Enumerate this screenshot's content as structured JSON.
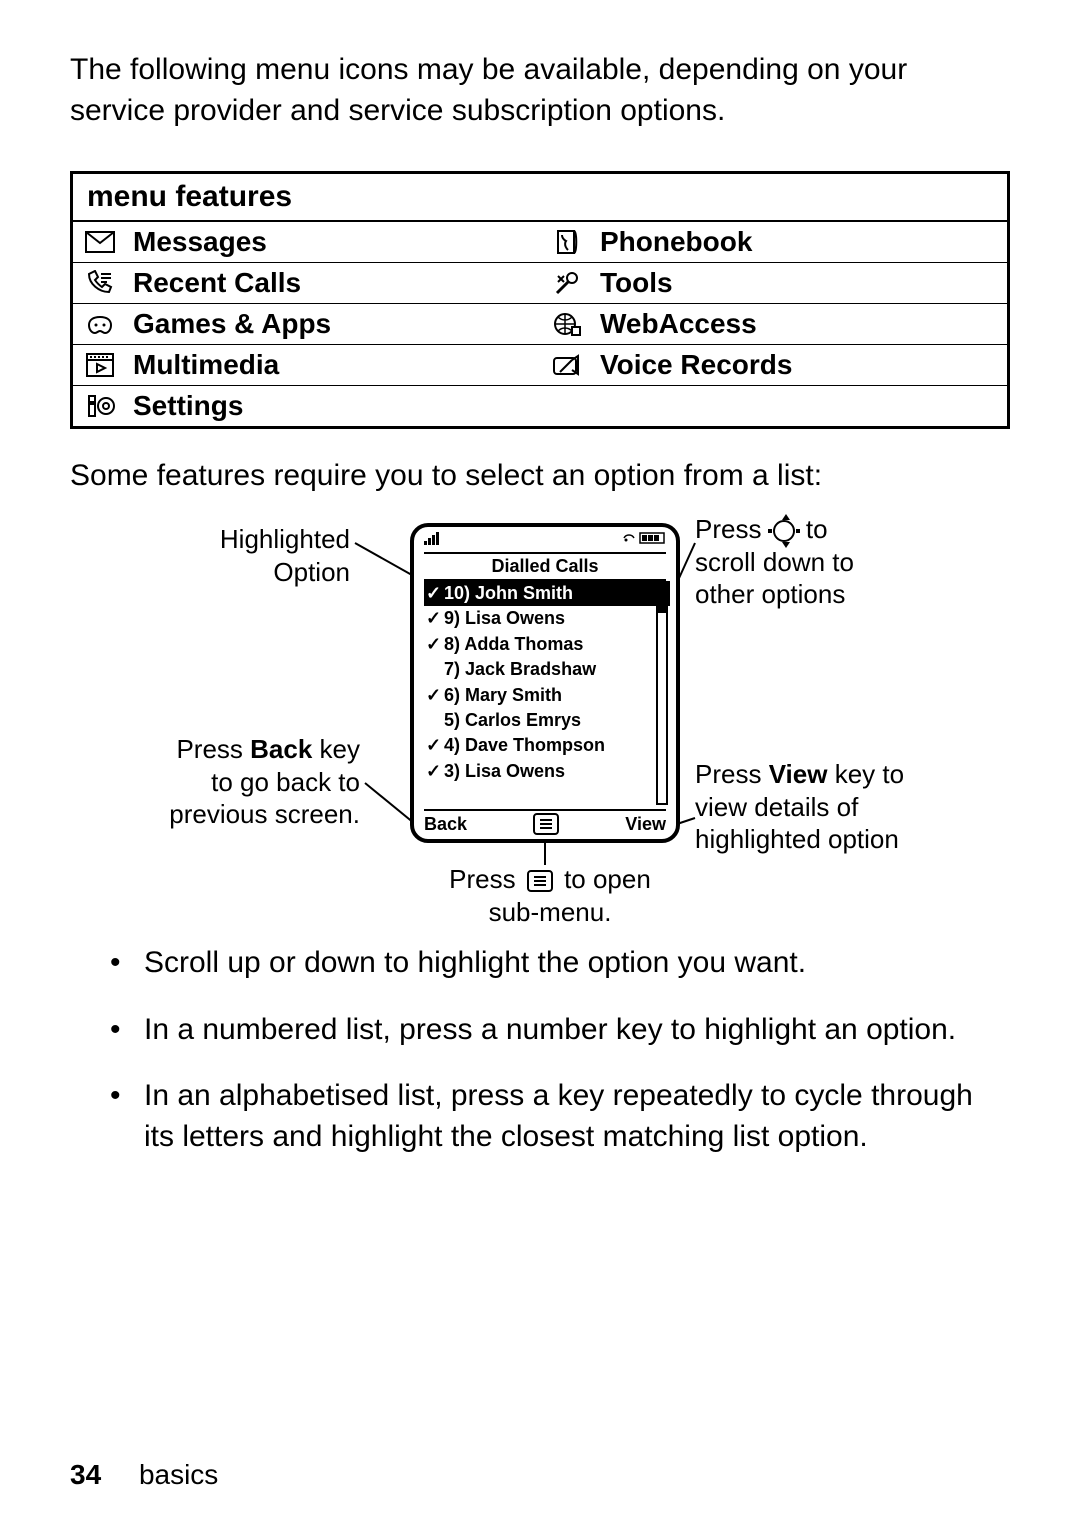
{
  "intro": "The following menu icons may be available, depending on your service provider and service subscription options.",
  "menu": {
    "header": "menu features",
    "rows": [
      {
        "left": {
          "icon": "envelope-icon",
          "label": "Messages"
        },
        "right": {
          "icon": "phonebook-icon",
          "label": "Phonebook"
        }
      },
      {
        "left": {
          "icon": "recent-calls-icon",
          "label": "Recent Calls"
        },
        "right": {
          "icon": "tools-icon",
          "label": "Tools"
        }
      },
      {
        "left": {
          "icon": "games-icon",
          "label": "Games & Apps"
        },
        "right": {
          "icon": "globe-icon",
          "label": "WebAccess"
        }
      },
      {
        "left": {
          "icon": "multimedia-icon",
          "label": "Multimedia"
        },
        "right": {
          "icon": "voice-records-icon",
          "label": "Voice Records"
        }
      },
      {
        "left": {
          "icon": "settings-icon",
          "label": "Settings"
        },
        "right": null
      }
    ]
  },
  "mid": "Some features require you to select an option from a list:",
  "phone": {
    "title": "Dialled Calls",
    "entries": [
      {
        "chk": true,
        "n": "10",
        "name": "John Smith",
        "hl": true
      },
      {
        "chk": true,
        "n": "9",
        "name": "Lisa Owens"
      },
      {
        "chk": true,
        "n": "8",
        "name": "Adda Thomas"
      },
      {
        "chk": false,
        "n": "7",
        "name": "Jack Bradshaw"
      },
      {
        "chk": true,
        "n": "6",
        "name": "Mary Smith"
      },
      {
        "chk": false,
        "n": "5",
        "name": "Carlos Emrys"
      },
      {
        "chk": true,
        "n": "4",
        "name": "Dave Thompson"
      },
      {
        "chk": true,
        "n": "3",
        "name": "Lisa Owens"
      }
    ],
    "left_soft": "Back",
    "right_soft": "View"
  },
  "callouts": {
    "highlighted_l1": "Highlighted",
    "highlighted_l2": "Option",
    "scroll_l1": "Press ",
    "scroll_l2": " to",
    "scroll_l3": "scroll down to",
    "scroll_l4": "other options",
    "back_l1": "Press ",
    "back_b": "Back",
    "back_l2": " key",
    "back_l3": "to go back to",
    "back_l4": "previous screen.",
    "view_l1": "Press ",
    "view_b": "View",
    "view_l2": " key to",
    "view_l3": "view details of",
    "view_l4": "highlighted option",
    "submenu_l1": "Press ",
    "submenu_l2": " to open",
    "submenu_l3": "sub-menu."
  },
  "tips": [
    "Scroll up or down to highlight the option you want.",
    "In a numbered list, press a number key to highlight an option.",
    "In an alphabetised list, press a key repeatedly to cycle through its letters and highlight the closest matching list option."
  ],
  "footer": {
    "page": "34",
    "section": "basics"
  }
}
